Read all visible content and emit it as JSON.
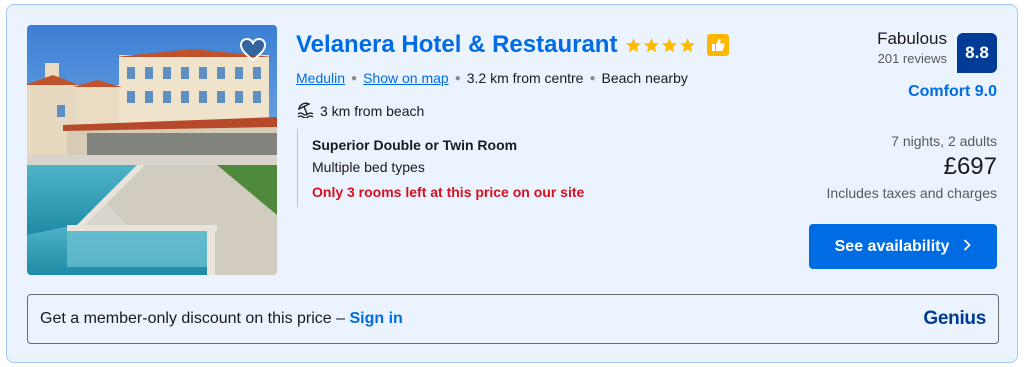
{
  "property": {
    "name": "Velanera Hotel & Restaurant",
    "star_count": 4,
    "star_color": "#febb02",
    "badge_icon": "thumbs-up-icon",
    "favorite_icon": "heart-icon"
  },
  "location": {
    "city": "Medulin",
    "map_link": "Show on map",
    "distance": "3.2 km from centre",
    "beach_note": "Beach nearby",
    "beach_distance": "3 km from beach"
  },
  "room": {
    "name": "Superior Double or Twin Room",
    "beds": "Multiple bed types",
    "availability_warning": "Only 3 rooms left at this price on our site"
  },
  "review": {
    "word": "Fabulous",
    "count": "201 reviews",
    "score": "8.8",
    "comfort": "Comfort 9.0"
  },
  "price": {
    "stay": "7 nights, 2 adults",
    "amount": "£697",
    "taxes": "Includes taxes and charges"
  },
  "cta": {
    "label": "See availability",
    "icon": "chevron-right-icon"
  },
  "member": {
    "text": "Get a member-only discount on this price –",
    "sign_in": "Sign in",
    "brand": "Genius"
  },
  "colors": {
    "primary": "#006ce4",
    "dark_blue": "#003b95",
    "warning_red": "#d4111e",
    "card_bg": "#ebf3ff"
  }
}
